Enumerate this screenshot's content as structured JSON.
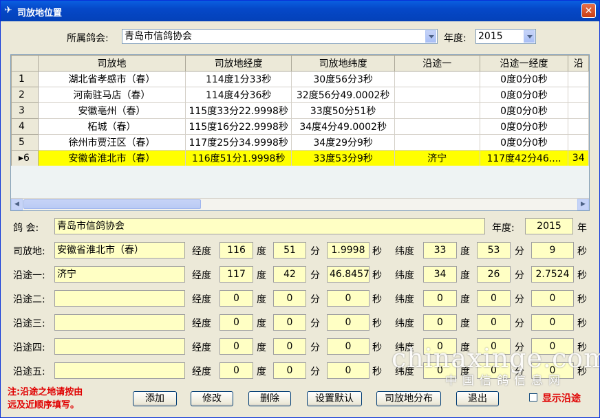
{
  "window": {
    "title": "司放地位置",
    "close_label": "✕",
    "app_icon": "pigeon-icon"
  },
  "top": {
    "club_label": "所属鸽会:",
    "club_value": "青岛市信鸽协会",
    "year_label": "年度:",
    "year_value": "2015"
  },
  "grid": {
    "columns": [
      "司放地",
      "司放地经度",
      "司放地纬度",
      "沿途一",
      "沿途一经度",
      "沿"
    ],
    "rows": [
      {
        "n": "1",
        "place": "湖北省孝感市（春）",
        "lng": "114度1分33秒",
        "lat": "30度56分3秒",
        "v1": "",
        "v1lng": "0度0分0秒",
        "more": ""
      },
      {
        "n": "2",
        "place": "河南驻马店（春）",
        "lng": "114度4分36秒",
        "lat": "32度56分49.0002秒",
        "v1": "",
        "v1lng": "0度0分0秒",
        "more": ""
      },
      {
        "n": "3",
        "place": "安徽亳州（春）",
        "lng": "115度33分22.9998秒",
        "lat": "33度50分51秒",
        "v1": "",
        "v1lng": "0度0分0秒",
        "more": ""
      },
      {
        "n": "4",
        "place": "柘城（春）",
        "lng": "115度16分22.9998秒",
        "lat": "34度4分49.0002秒",
        "v1": "",
        "v1lng": "0度0分0秒",
        "more": ""
      },
      {
        "n": "5",
        "place": "徐州市贾汪区（春）",
        "lng": "117度25分34.9998秒",
        "lat": "34度29分9秒",
        "v1": "",
        "v1lng": "0度0分0秒",
        "more": ""
      },
      {
        "n": "6",
        "place": "安徽省淮北市（春）",
        "lng": "116度51分1.9998秒",
        "lat": "33度53分9秒",
        "v1": "济宁",
        "v1lng": "117度42分46....",
        "more": "34"
      }
    ],
    "selected_marker": "▸",
    "selected_row": 6
  },
  "form": {
    "club_label": "鸽  会:",
    "club_value": "青岛市信鸽协会",
    "year_label": "年度:",
    "year_value": "2015",
    "year_unit": "年",
    "lng_label": "经度",
    "lat_label": "纬度",
    "deg": "度",
    "min": "分",
    "sec": "秒",
    "rows": [
      {
        "label": "司放地:",
        "name": "安徽省淮北市（春）",
        "lng_d": "116",
        "lng_m": "51",
        "lng_s": "1.9998",
        "lat_d": "33",
        "lat_m": "53",
        "lat_s": "9"
      },
      {
        "label": "沿途一:",
        "name": "济宁",
        "lng_d": "117",
        "lng_m": "42",
        "lng_s": "46.8457",
        "lat_d": "34",
        "lat_m": "26",
        "lat_s": "2.7524"
      },
      {
        "label": "沿途二:",
        "name": "",
        "lng_d": "0",
        "lng_m": "0",
        "lng_s": "0",
        "lat_d": "0",
        "lat_m": "0",
        "lat_s": "0"
      },
      {
        "label": "沿途三:",
        "name": "",
        "lng_d": "0",
        "lng_m": "0",
        "lng_s": "0",
        "lat_d": "0",
        "lat_m": "0",
        "lat_s": "0"
      },
      {
        "label": "沿途四:",
        "name": "",
        "lng_d": "0",
        "lng_m": "0",
        "lng_s": "0",
        "lat_d": "0",
        "lat_m": "0",
        "lat_s": "0"
      },
      {
        "label": "沿途五:",
        "name": "",
        "lng_d": "0",
        "lng_m": "0",
        "lng_s": "0",
        "lat_d": "0",
        "lat_m": "0",
        "lat_s": "0"
      }
    ]
  },
  "note": {
    "line1": "注:沿途之地请按由",
    "line2": "远及近顺序填写。"
  },
  "buttons": {
    "add": "添加",
    "edit": "修改",
    "delete": "删除",
    "default": "设置默认",
    "distribution": "司放地分布",
    "exit": "退出"
  },
  "show_route_label": "显示沿途",
  "watermark": {
    "text": "chinaxinge.com",
    "sub": "中国信鸽信息网"
  },
  "colors": {
    "title_bar": "#0548c8",
    "selected_row": "#ffff00",
    "field_bg": "#ffffc4",
    "note": "#e00000"
  }
}
